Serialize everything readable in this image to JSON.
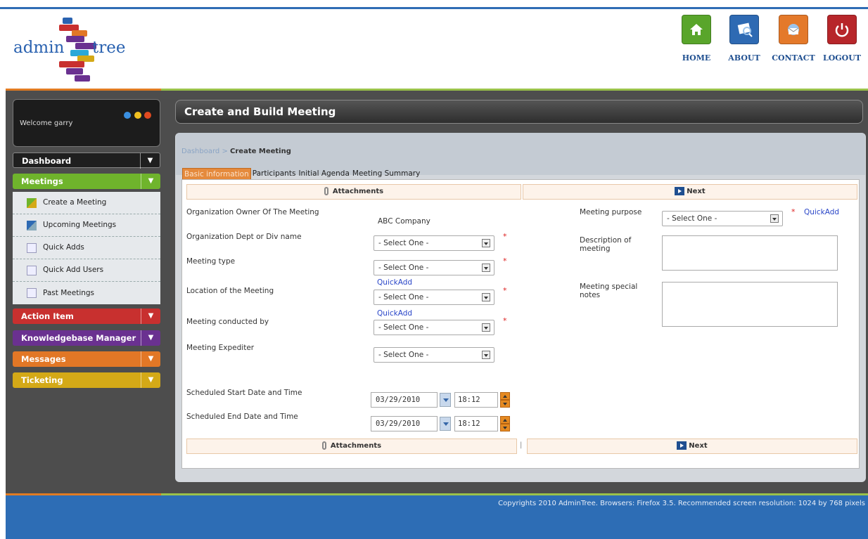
{
  "logo": {
    "word1": "admin",
    "word2": "tree"
  },
  "topnav": [
    {
      "label": "HOME",
      "icon": "home-icon",
      "color": "#59a52b"
    },
    {
      "label": "ABOUT",
      "icon": "about-icon",
      "color": "#2e6ab3"
    },
    {
      "label": "CONTACT",
      "icon": "contact-icon",
      "color": "#e4792a"
    },
    {
      "label": "LOGOUT",
      "icon": "power-icon",
      "color": "#b7262a"
    }
  ],
  "sidebar": {
    "welcome": "Welcome garry",
    "menus": [
      {
        "label": "Dashboard",
        "color": "#1f1f1f"
      },
      {
        "label": "Meetings",
        "color": "#6fb42c"
      },
      {
        "label": "Action Item",
        "color": "#c8302f"
      },
      {
        "label": "Knowledgebase Manager",
        "color": "#6a3190"
      },
      {
        "label": "Messages",
        "color": "#e27726"
      },
      {
        "label": "Ticketing",
        "color": "#d4a917"
      }
    ],
    "submenu": [
      {
        "label": "Create a Meeting",
        "icon": "create-meeting-icon"
      },
      {
        "label": "Upcoming Meetings",
        "icon": "upcoming-meetings-icon"
      },
      {
        "label": "Quick Adds",
        "icon": "quick-adds-icon"
      },
      {
        "label": "Quick Add Users",
        "icon": "quick-add-users-icon"
      },
      {
        "label": "Past Meetings",
        "icon": "past-meetings-icon"
      }
    ]
  },
  "page": {
    "title": "Create and Build Meeting",
    "breadcrumb": {
      "root": "Dashboard",
      "sep": ">",
      "current": "Create Meeting"
    },
    "tabs": [
      "Basic information",
      "Participants",
      "Initial Agenda",
      "Meeting Summary"
    ],
    "active_tab": "Basic information"
  },
  "form": {
    "attachments_label": "Attachments",
    "next_label": "Next",
    "owner_label": "Organization Owner Of The Meeting",
    "owner_value": "ABC Company",
    "dept_label": "Organization Dept or Div name",
    "type_label": "Meeting type",
    "location_label": "Location of the Meeting",
    "conducted_label": "Meeting conducted by",
    "expediter_label": "Meeting Expediter",
    "start_label": "Scheduled Start Date and Time",
    "end_label": "Scheduled End Date and Time",
    "purpose_label": "Meeting purpose",
    "description_label": "Description of meeting",
    "notes_label": "Meeting special notes",
    "select_placeholder": "- Select One -",
    "quickadd": "QuickAdd",
    "required_mark": "*",
    "start_date": "03/29/2010",
    "start_time": "18:12",
    "end_date": "03/29/2010",
    "end_time": "18:12",
    "bottom_separator": "|"
  },
  "footer": {
    "copyright": "Copyrights 2010 AdminTree. Browsers: Firefox 3.5. Recommended screen resolution: 1024 by 768 pixels"
  }
}
